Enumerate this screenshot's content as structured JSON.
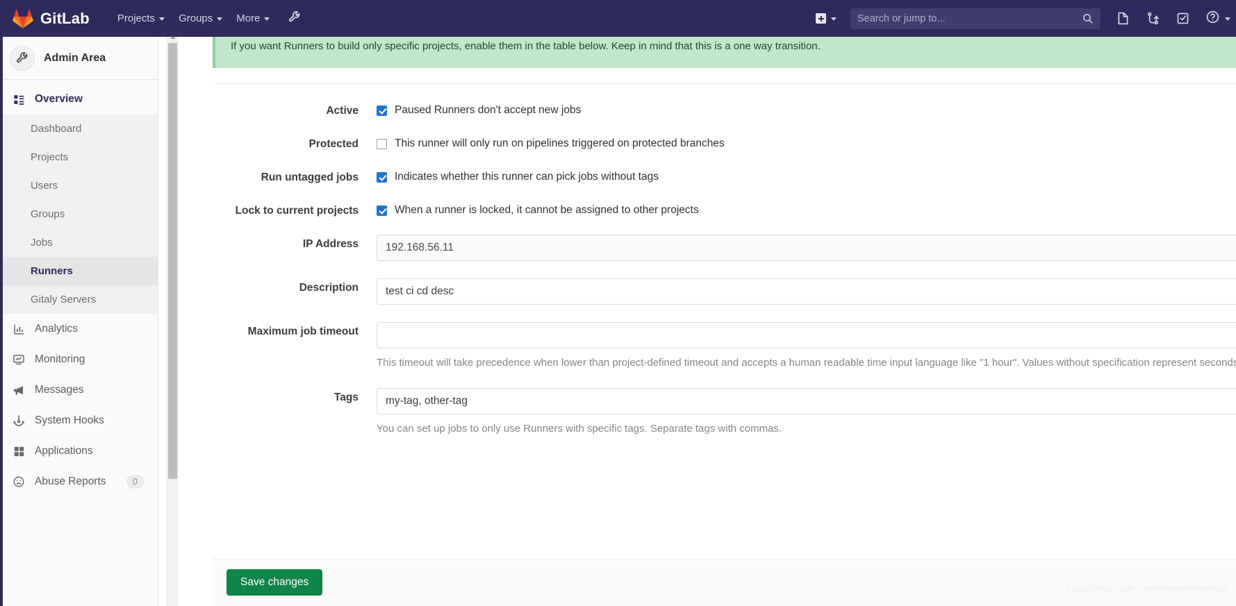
{
  "navbar": {
    "brand": "GitLab",
    "logo_icon": "gitlab-tanuki-icon",
    "links": [
      {
        "label": "Projects",
        "icon": "chevron-down-icon"
      },
      {
        "label": "Groups",
        "icon": "chevron-down-icon"
      },
      {
        "label": "More",
        "icon": "chevron-down-icon"
      }
    ],
    "wrench_icon": "wrench-icon",
    "new_icon": "plus-square-icon",
    "new_caret_icon": "chevron-down-icon",
    "search": {
      "placeholder": "Search or jump to...",
      "value": "",
      "icon": "search-icon"
    },
    "right_icons": [
      {
        "name": "issues-icon"
      },
      {
        "name": "merge-requests-icon"
      },
      {
        "name": "todos-icon"
      },
      {
        "name": "help-icon"
      }
    ]
  },
  "sidebar": {
    "title": "Admin Area",
    "avatar_icon": "wrench-icon",
    "overview": {
      "label": "Overview",
      "icon": "overview-grid-icon",
      "children": [
        {
          "label": "Dashboard",
          "selected": false
        },
        {
          "label": "Projects",
          "selected": false
        },
        {
          "label": "Users",
          "selected": false
        },
        {
          "label": "Groups",
          "selected": false
        },
        {
          "label": "Jobs",
          "selected": false
        },
        {
          "label": "Runners",
          "selected": true
        },
        {
          "label": "Gitaly Servers",
          "selected": false
        }
      ]
    },
    "items": [
      {
        "label": "Analytics",
        "icon": "chart-bar-icon",
        "badge": null
      },
      {
        "label": "Monitoring",
        "icon": "monitor-icon",
        "badge": null
      },
      {
        "label": "Messages",
        "icon": "megaphone-icon",
        "badge": null
      },
      {
        "label": "System Hooks",
        "icon": "hook-icon",
        "badge": null
      },
      {
        "label": "Applications",
        "icon": "applications-grid-icon",
        "badge": null
      },
      {
        "label": "Abuse Reports",
        "icon": "abuse-face-icon",
        "badge": "0"
      }
    ]
  },
  "alert": {
    "heading": "",
    "text": "If you want Runners to build only specific projects, enable them in the table below. Keep in mind that this is a one way transition."
  },
  "form": {
    "rows": [
      {
        "label": "Active",
        "type": "checkbox",
        "checked": true,
        "text": "Paused Runners don't accept new jobs"
      },
      {
        "label": "Protected",
        "type": "checkbox",
        "checked": false,
        "text": "This runner will only run on pipelines triggered on protected branches"
      },
      {
        "label": "Run untagged jobs",
        "type": "checkbox",
        "checked": true,
        "text": "Indicates whether this runner can pick jobs without tags"
      },
      {
        "label": "Lock to current projects",
        "type": "checkbox",
        "checked": true,
        "text": "When a runner is locked, it cannot be assigned to other projects"
      },
      {
        "label": "IP Address",
        "type": "text",
        "value": "192.168.56.11",
        "placeholder": "",
        "readonly": true,
        "help": ""
      },
      {
        "label": "Description",
        "type": "text",
        "value": "test ci cd desc",
        "placeholder": "",
        "readonly": false,
        "help": ""
      },
      {
        "label": "Maximum job timeout",
        "type": "text",
        "value": "",
        "placeholder": "",
        "readonly": false,
        "help": "This timeout will take precedence when lower than project-defined timeout and accepts a human readable time input language like \"1 hour\". Values without specification represent seconds."
      },
      {
        "label": "Tags",
        "type": "text",
        "value": "my-tag, other-tag",
        "placeholder": "",
        "readonly": false,
        "help": "You can set up jobs to only use Runners with specific tags. Separate tags with commas."
      }
    ],
    "save_label": "Save changes"
  },
  "watermark": "https://blog.csdn.net/ProgrammingWay",
  "colors": {
    "navbar_bg": "#2e2a5b",
    "accent": "#2e2a5b",
    "success_btn": "#108548",
    "alert_bg": "#c3e6cb",
    "checkbox_on": "#1f75cb"
  }
}
